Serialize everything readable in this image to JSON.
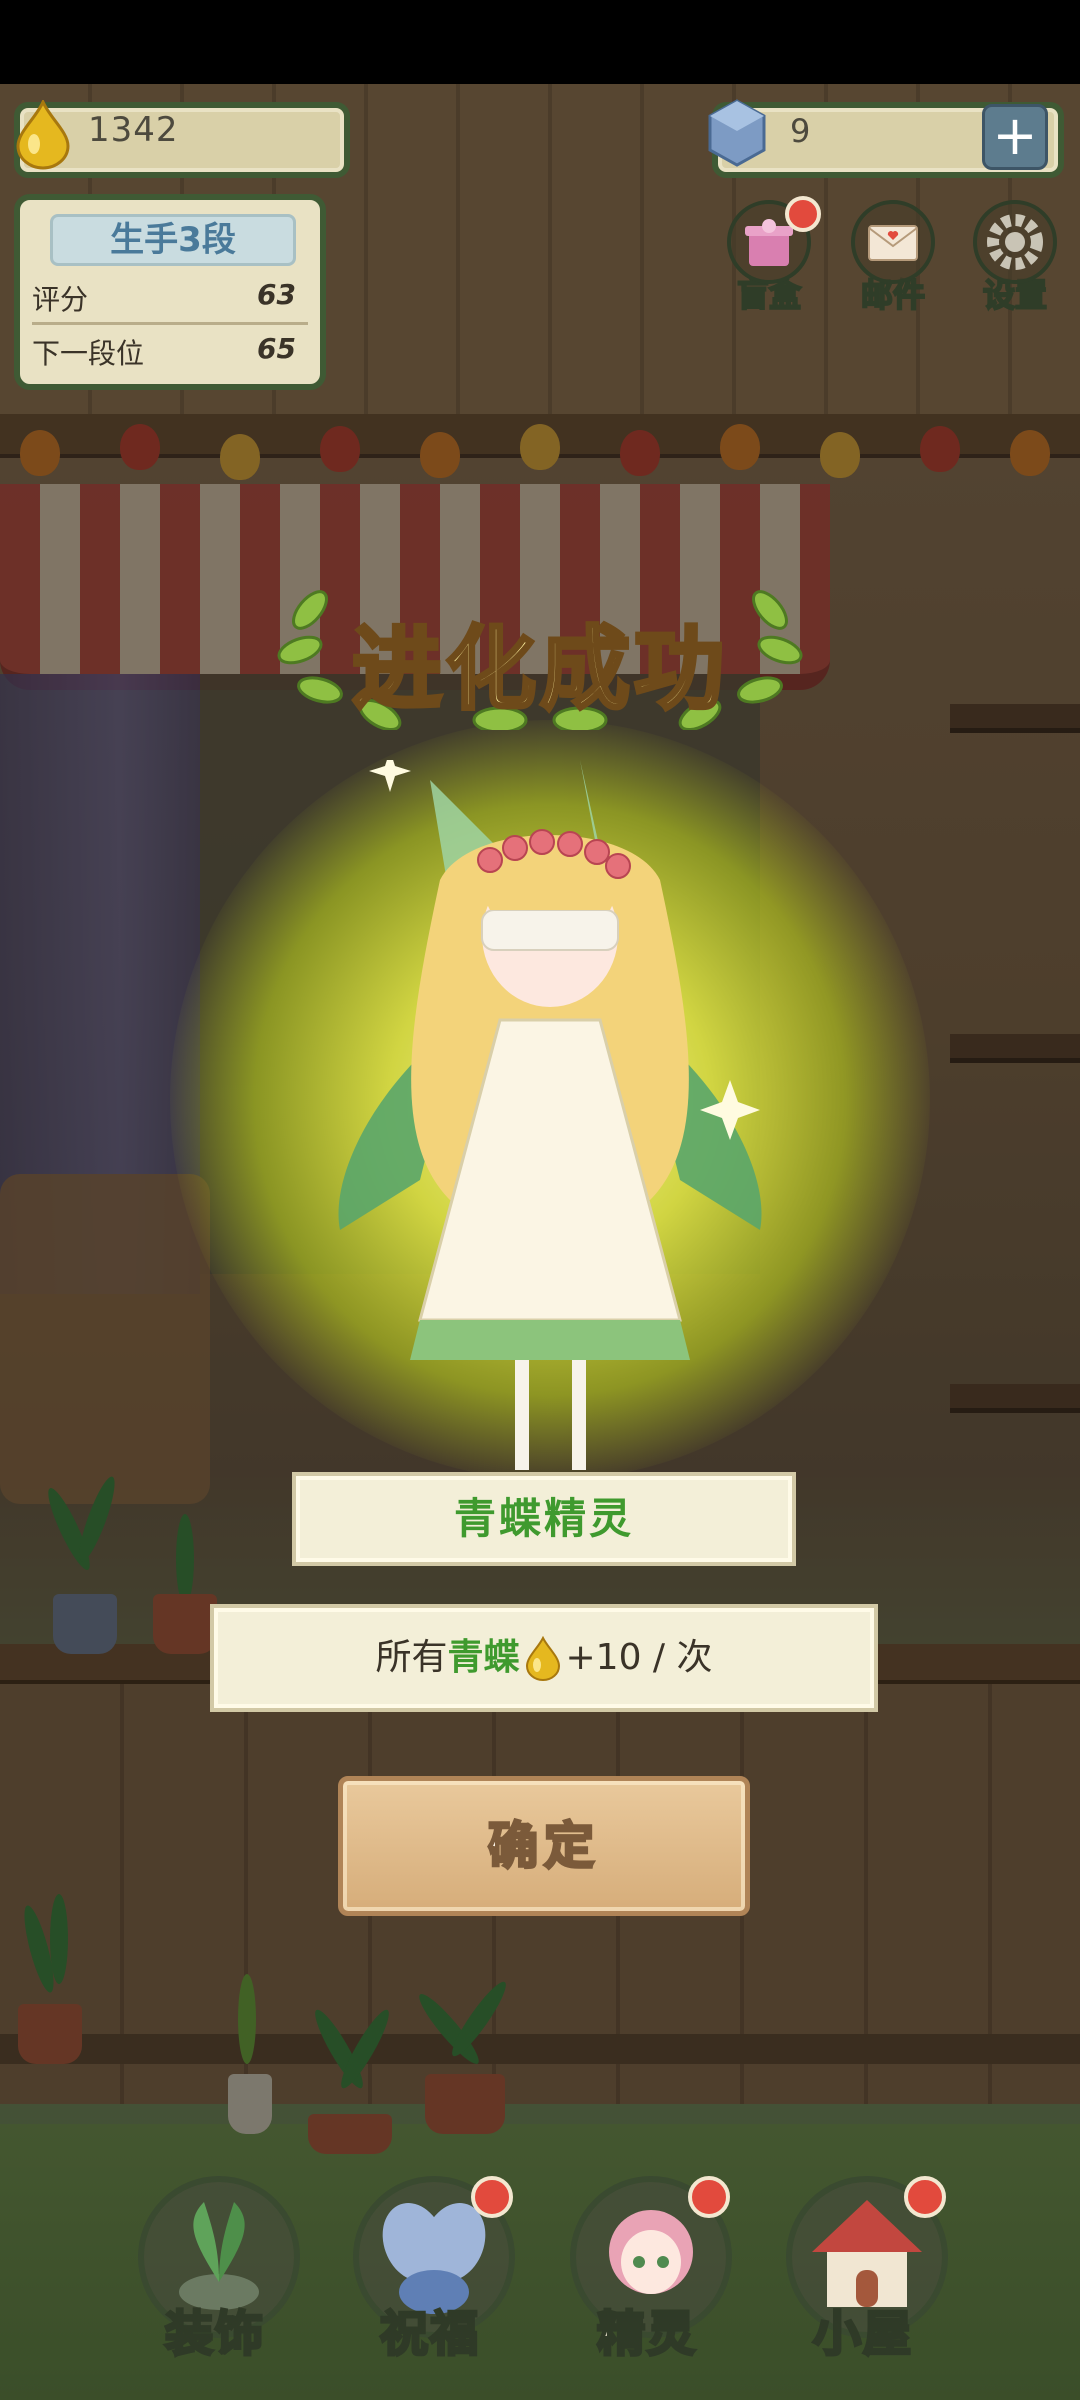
{
  "hud": {
    "coins": "1342",
    "gems": "9",
    "gem_add_symbol": "+"
  },
  "rank": {
    "title": "生手3段",
    "score_label": "评分",
    "score_value": "63",
    "next_label": "下一段位",
    "next_value": "65"
  },
  "top_menu": [
    {
      "label": "盲盒",
      "icon": "blind-box-icon",
      "badge": true
    },
    {
      "label": "邮件",
      "icon": "mail-icon",
      "badge": false
    },
    {
      "label": "设置",
      "icon": "gear-icon",
      "badge": false
    }
  ],
  "popup": {
    "title": "进化成功",
    "fairy_name": "青蝶精灵",
    "effect_prefix": "所有",
    "effect_highlight": "青蝶",
    "effect_suffix": "+10 / 次",
    "confirm_label": "确定"
  },
  "bottom_nav": [
    {
      "label": "装饰",
      "icon": "plant-decor-icon",
      "badge": false
    },
    {
      "label": "祝福",
      "icon": "butterfly-blessing-icon",
      "badge": true
    },
    {
      "label": "精灵",
      "icon": "fairy-icon",
      "badge": true
    },
    {
      "label": "小屋",
      "icon": "house-icon",
      "badge": true
    }
  ],
  "colors": {
    "accent_green": "#3f9a2e",
    "hud_border": "#3f5a34",
    "badge_red": "#e24a3d",
    "button_tan": "#d6ad7a"
  }
}
